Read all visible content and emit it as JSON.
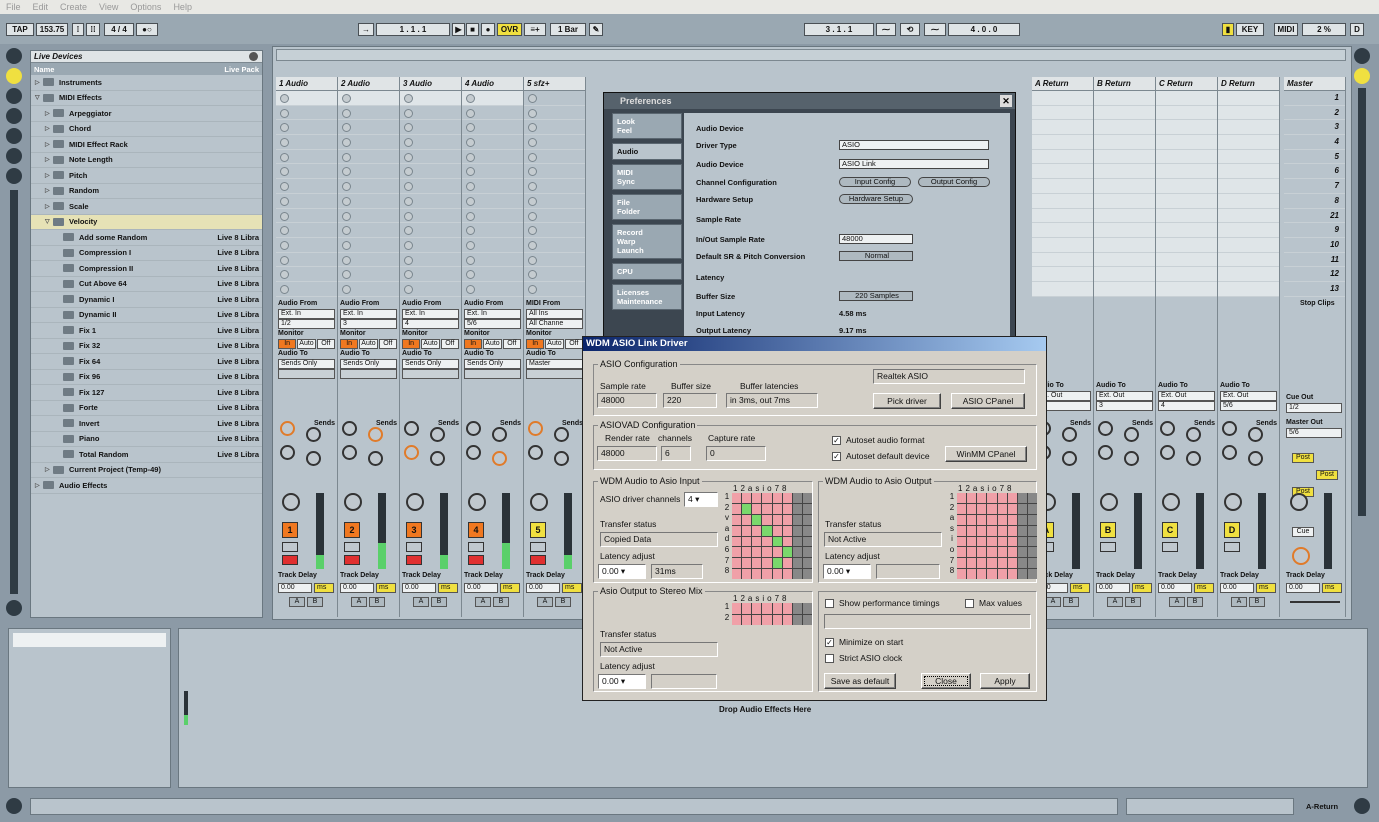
{
  "menu": [
    "File",
    "Edit",
    "Create",
    "View",
    "Options",
    "Help"
  ],
  "transport": {
    "tap": "TAP",
    "tempo": "153.75",
    "sig": "4 / 4",
    "loop_pos": "1 . 1 . 1",
    "ovr": "OVR",
    "quant": "1 Bar",
    "punch_in": "3 . 1 . 1",
    "punch_len": "4 . 0 . 0",
    "key": "KEY",
    "midi": "MIDI",
    "cpu": "2 %",
    "disk": "D"
  },
  "browser": {
    "title": "Live Devices",
    "col_name": "Name",
    "col_pack": "Live Pack",
    "items": [
      {
        "label": "Instruments",
        "pack": "",
        "indent": 0,
        "tri": "▷",
        "sel": false
      },
      {
        "label": "MIDI Effects",
        "pack": "",
        "indent": 0,
        "tri": "▽",
        "sel": false
      },
      {
        "label": "Arpeggiator",
        "pack": "",
        "indent": 1,
        "tri": "▷",
        "sel": false
      },
      {
        "label": "Chord",
        "pack": "",
        "indent": 1,
        "tri": "▷",
        "sel": false
      },
      {
        "label": "MIDI Effect Rack",
        "pack": "",
        "indent": 1,
        "tri": "▷",
        "sel": false
      },
      {
        "label": "Note Length",
        "pack": "",
        "indent": 1,
        "tri": "▷",
        "sel": false
      },
      {
        "label": "Pitch",
        "pack": "",
        "indent": 1,
        "tri": "▷",
        "sel": false
      },
      {
        "label": "Random",
        "pack": "",
        "indent": 1,
        "tri": "▷",
        "sel": false
      },
      {
        "label": "Scale",
        "pack": "",
        "indent": 1,
        "tri": "▷",
        "sel": false
      },
      {
        "label": "Velocity",
        "pack": "",
        "indent": 1,
        "tri": "▽",
        "sel": true
      },
      {
        "label": "Add some Random",
        "pack": "Live 8 Libra",
        "indent": 2,
        "tri": "",
        "sel": false
      },
      {
        "label": "Compression I",
        "pack": "Live 8 Libra",
        "indent": 2,
        "tri": "",
        "sel": false
      },
      {
        "label": "Compression II",
        "pack": "Live 8 Libra",
        "indent": 2,
        "tri": "",
        "sel": false
      },
      {
        "label": "Cut Above 64",
        "pack": "Live 8 Libra",
        "indent": 2,
        "tri": "",
        "sel": false
      },
      {
        "label": "Dynamic I",
        "pack": "Live 8 Libra",
        "indent": 2,
        "tri": "",
        "sel": false
      },
      {
        "label": "Dynamic II",
        "pack": "Live 8 Libra",
        "indent": 2,
        "tri": "",
        "sel": false
      },
      {
        "label": "Fix 1",
        "pack": "Live 8 Libra",
        "indent": 2,
        "tri": "",
        "sel": false
      },
      {
        "label": "Fix 32",
        "pack": "Live 8 Libra",
        "indent": 2,
        "tri": "",
        "sel": false
      },
      {
        "label": "Fix 64",
        "pack": "Live 8 Libra",
        "indent": 2,
        "tri": "",
        "sel": false
      },
      {
        "label": "Fix 96",
        "pack": "Live 8 Libra",
        "indent": 2,
        "tri": "",
        "sel": false
      },
      {
        "label": "Fix 127",
        "pack": "Live 8 Libra",
        "indent": 2,
        "tri": "",
        "sel": false
      },
      {
        "label": "Forte",
        "pack": "Live 8 Libra",
        "indent": 2,
        "tri": "",
        "sel": false
      },
      {
        "label": "Invert",
        "pack": "Live 8 Libra",
        "indent": 2,
        "tri": "",
        "sel": false
      },
      {
        "label": "Piano",
        "pack": "Live 8 Libra",
        "indent": 2,
        "tri": "",
        "sel": false
      },
      {
        "label": "Total Random",
        "pack": "Live 8 Libra",
        "indent": 2,
        "tri": "",
        "sel": false
      },
      {
        "label": "Current Project (Temp-49)",
        "pack": "",
        "indent": 1,
        "tri": "▷",
        "sel": false
      },
      {
        "label": "Audio Effects",
        "pack": "",
        "indent": 0,
        "tri": "▷",
        "sel": false
      }
    ]
  },
  "tracks": [
    {
      "name": "1 Audio",
      "from": "Ext. In",
      "ch": "1/2",
      "to": "Sends Only",
      "num": "1",
      "color": "#f07820"
    },
    {
      "name": "2 Audio",
      "from": "Ext. In",
      "ch": "3",
      "to": "Sends Only",
      "num": "2",
      "color": "#f07820"
    },
    {
      "name": "3 Audio",
      "from": "Ext. In",
      "ch": "4",
      "to": "Sends Only",
      "num": "3",
      "color": "#f07820"
    },
    {
      "name": "4 Audio",
      "from": "Ext. In",
      "ch": "5/6",
      "to": "Sends Only",
      "num": "4",
      "color": "#f07820"
    },
    {
      "name": "5 sfz+",
      "from": "All Ins",
      "ch": "All Channe",
      "to": "Master",
      "num": "5",
      "color": "#f0e040"
    }
  ],
  "returns": [
    {
      "name": "A Return",
      "to": "Ext. Out",
      "ch": "",
      "num": "A"
    },
    {
      "name": "B Return",
      "to": "Ext. Out",
      "ch": "3",
      "num": "B"
    },
    {
      "name": "C Return",
      "to": "Ext. Out",
      "ch": "4",
      "num": "C"
    },
    {
      "name": "D Return",
      "to": "Ext. Out",
      "ch": "5/6",
      "num": "D"
    }
  ],
  "master": {
    "name": "Master",
    "scenes": [
      "1",
      "2",
      "3",
      "4",
      "5",
      "6",
      "7",
      "8",
      "21",
      "9",
      "10",
      "11",
      "12",
      "13"
    ],
    "stop_clips": "Stop Clips",
    "cue_out": "Cue Out",
    "cue_out_val": "1/2",
    "master_out": "Master Out",
    "master_out_val": "5/6",
    "cue": "Cue",
    "post": "Post"
  },
  "mixer_labels": {
    "audio_from": "Audio From",
    "midi_from": "MIDI From",
    "monitor": "Monitor",
    "in": "In",
    "auto": "Auto",
    "off": "Off",
    "audio_to": "Audio To",
    "sends": "Sends",
    "track_delay": "Track Delay",
    "delay_val": "0.00",
    "ms": "ms",
    "a": "A",
    "b": "B"
  },
  "drop_zone": "Drop Audio Effects Here",
  "status_right": "A-Return",
  "prefs": {
    "title": "Preferences",
    "tabs": [
      "Look\nFeel",
      "Audio",
      "MIDI\nSync",
      "File\nFolder",
      "Record\nWarp\nLaunch",
      "CPU",
      "Licenses\nMaintenance"
    ],
    "audio_device": "Audio Device",
    "driver_type_l": "Driver Type",
    "driver_type": "ASIO",
    "audio_device_l": "Audio Device",
    "audio_device_v": "ASIO Link",
    "chan_conf_l": "Channel Configuration",
    "input_config": "Input Config",
    "output_config": "Output Config",
    "hw_setup_l": "Hardware Setup",
    "hw_setup": "Hardware Setup",
    "sample_rate": "Sample Rate",
    "inout_sr_l": "In/Out Sample Rate",
    "inout_sr": "48000",
    "default_sr_l": "Default SR & Pitch Conversion",
    "default_sr": "Normal",
    "latency": "Latency",
    "buffer_l": "Buffer Size",
    "buffer": "220 Samples",
    "in_lat_l": "Input Latency",
    "in_lat": "4.58 ms",
    "out_lat_l": "Output Latency",
    "out_lat": "9.17 ms"
  },
  "asio": {
    "title": "WDM ASIO Link Driver",
    "asio_conf": "ASIO Configuration",
    "sr_l": "Sample rate",
    "sr": "48000",
    "buf_l": "Buffer size",
    "buf": "220",
    "lat_l": "Buffer latencies",
    "lat": "in 3ms, out 7ms",
    "driver_name": "Realtek ASIO",
    "pick": "Pick driver",
    "cpanel": "ASIO CPanel",
    "vad_conf": "ASIOVAD Configuration",
    "rr_l": "Render rate",
    "rr": "48000",
    "ch_l": "channels",
    "ch": "6",
    "cap_l": "Capture rate",
    "cap": "0",
    "autoset_fmt": "Autoset audio format",
    "autoset_dev": "Autoset default device",
    "winmm": "WinMM CPanel",
    "wdm_in": "WDM Audio to Asio Input",
    "drv_ch_l": "ASIO driver channels",
    "drv_ch": "4",
    "ts_l": "Transfer status",
    "ts_in": "Copied Data",
    "la_l": "Latency adjust",
    "la_in": "0.00",
    "la_in_ms": "31ms",
    "wdm_out": "WDM Audio to Asio Output",
    "ts_out": "Not Active",
    "la_out": "0.00",
    "stereo": "Asio Output to Stereo Mix",
    "ts_st": "Not Active",
    "la_st": "0.00",
    "matrix_head": "12asio78",
    "matrix_rows_in": [
      "1",
      "2",
      "v",
      "a",
      "d",
      "6",
      "7",
      "8"
    ],
    "matrix_rows_out": [
      "1",
      "2",
      "a",
      "s",
      "i",
      "o",
      "7",
      "8"
    ],
    "matrix_rows_st": [
      "1",
      "2"
    ],
    "show_perf": "Show performance timings",
    "max_values": "Max values",
    "minimize": "Minimize on start",
    "strict": "Strict ASIO clock",
    "save_default": "Save as default",
    "close": "Close",
    "apply": "Apply"
  }
}
